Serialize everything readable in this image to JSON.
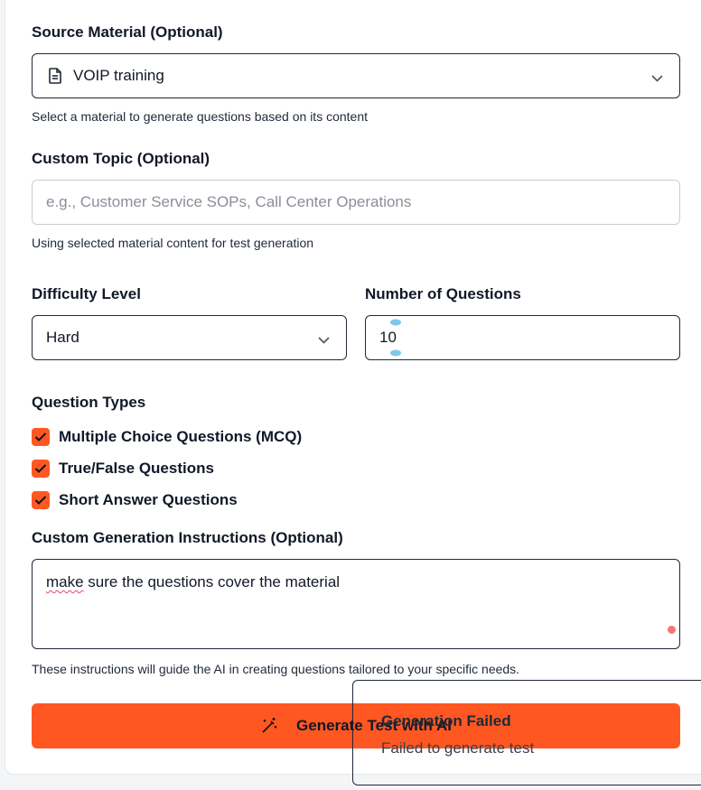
{
  "source_material": {
    "label": "Source Material (Optional)",
    "value": "VOIP training",
    "icon": "document-icon",
    "helper": "Select a material to generate questions based on its content"
  },
  "custom_topic": {
    "label": "Custom Topic (Optional)",
    "placeholder": "e.g., Customer Service SOPs, Call Center Operations",
    "helper": "Using selected material content for test generation"
  },
  "difficulty": {
    "label": "Difficulty Level",
    "value": "Hard"
  },
  "num_questions": {
    "label": "Number of Questions",
    "value": "10"
  },
  "question_types": {
    "label": "Question Types",
    "items": [
      {
        "label": "Multiple Choice Questions (MCQ)",
        "checked": true
      },
      {
        "label": "True/False Questions",
        "checked": true
      },
      {
        "label": "Short Answer Questions",
        "checked": true
      }
    ]
  },
  "instructions": {
    "label": "Custom Generation Instructions (Optional)",
    "value_first_word": "make",
    "value_rest": " sure the questions cover the material",
    "helper": "These instructions will guide the AI in creating questions tailored to your specific needs."
  },
  "generate_button": {
    "label": "Generate Test with AI",
    "icon": "magic-wand-icon"
  },
  "toast": {
    "title": "Generation Failed",
    "message": "Failed to generate test"
  },
  "colors": {
    "accent": "#ff5722",
    "border": "#1f2937",
    "spellcheck": "#e0457b"
  }
}
